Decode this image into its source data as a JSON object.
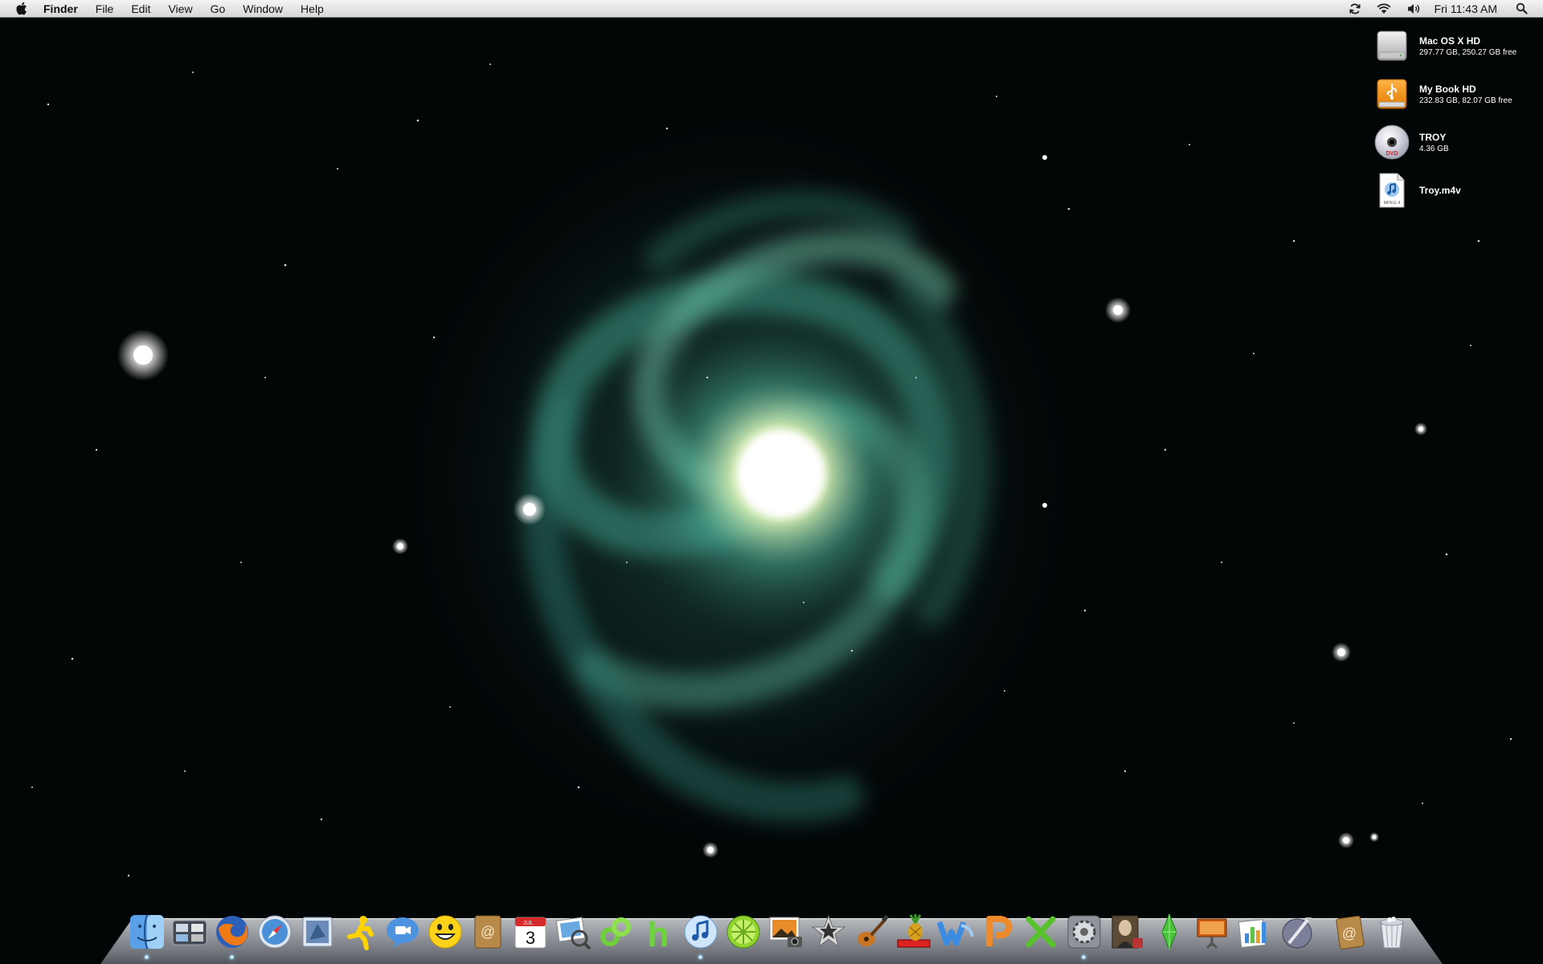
{
  "menubar": {
    "app_name": "Finder",
    "menus": [
      "File",
      "Edit",
      "View",
      "Go",
      "Window",
      "Help"
    ],
    "status_icons": [
      "sync-icon",
      "wifi-icon",
      "volume-icon"
    ],
    "clock": "Fri 11:43 AM",
    "spotlight_icon": "spotlight-icon"
  },
  "desktop": {
    "items": [
      {
        "name": "Mac OS X HD",
        "info": "297.77 GB, 250.27 GB free",
        "icon": "hard-drive-icon"
      },
      {
        "name": "My Book HD",
        "info": "232.83 GB, 82.07 GB free",
        "icon": "usb-drive-icon"
      },
      {
        "name": "TROY",
        "info": "4.36 GB",
        "icon": "dvd-icon"
      },
      {
        "name": "Troy.m4v",
        "info": "",
        "icon": "mpeg4-file-icon",
        "badge": "MPEG 4"
      }
    ]
  },
  "dock": {
    "apps": [
      "finder",
      "dashboard",
      "firefox",
      "safari",
      "mail",
      "aim",
      "ichat",
      "yahoo-messenger",
      "address-book",
      "ical",
      "iphoto-preview",
      "cloud-app",
      "h-app",
      "itunes",
      "limewire",
      "iphoto",
      "imovie",
      "garageband",
      "ical-special",
      "word",
      "powerpoint",
      "excel",
      "system-preferences",
      "portrait-app",
      "the-sims",
      "keynote",
      "numbers",
      "script-editor"
    ],
    "others": [
      "downloads-stack",
      "trash"
    ],
    "ical_date": "3",
    "ical_month": "JUL"
  }
}
